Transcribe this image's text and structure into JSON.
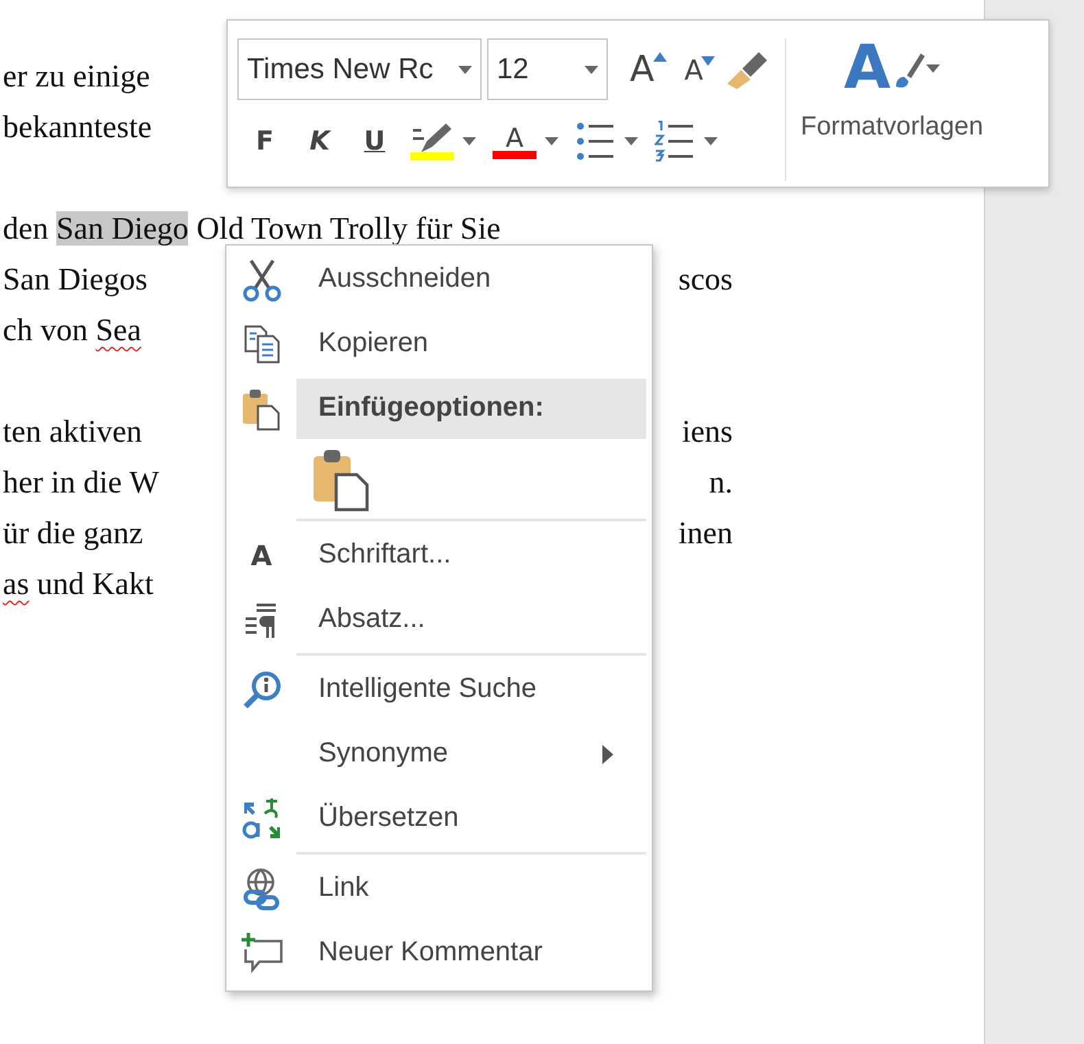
{
  "document": {
    "paragraphs": [
      {
        "lines": [
          {
            "segments": [
              {
                "text": "er zu einige",
                "selected": false,
                "misspelled": false
              }
            ]
          },
          {
            "segments": [
              {
                "text": "bekannteste",
                "selected": false,
                "misspelled": false
              }
            ]
          }
        ]
      },
      {
        "lines": [
          {
            "segments": [
              {
                "text": "den ",
                "selected": false,
                "misspelled": false
              },
              {
                "text": "San Diego",
                "selected": true,
                "misspelled": false
              },
              {
                "text": " Old Town Trolly für Sie",
                "selected": false,
                "misspelled": false
              }
            ]
          },
          {
            "segments": [
              {
                "text": "San Diegos",
                "selected": false,
                "misspelled": false
              }
            ],
            "right": "scos"
          },
          {
            "segments": [
              {
                "text": "ch von ",
                "selected": false,
                "misspelled": false
              },
              {
                "text": "Sea",
                "selected": false,
                "misspelled": true
              }
            ]
          }
        ]
      },
      {
        "lines": [
          {
            "segments": [
              {
                "text": "ten aktiven",
                "selected": false,
                "misspelled": false
              }
            ],
            "right": "iens"
          },
          {
            "segments": [
              {
                "text": "her in die W",
                "selected": false,
                "misspelled": false
              }
            ],
            "right": "n."
          },
          {
            "segments": [
              {
                "text": "ür die ganz",
                "selected": false,
                "misspelled": false
              }
            ],
            "right": "inen"
          },
          {
            "segments": [
              {
                "text": "as",
                "selected": false,
                "misspelled": true
              },
              {
                "text": " und Kakt",
                "selected": false,
                "misspelled": false
              }
            ]
          }
        ]
      }
    ]
  },
  "mini_toolbar": {
    "font": "Times New Rc",
    "size": "12",
    "grow_glyph": "A",
    "shrink_glyph": "A",
    "format_buttons": [
      {
        "kind": "bold",
        "label": "F"
      },
      {
        "kind": "italic",
        "label": "K"
      },
      {
        "kind": "underline",
        "label": "U"
      }
    ],
    "highlight": {
      "color": "#ffff00"
    },
    "font_color": {
      "glyph": "A",
      "color": "#ff0000"
    },
    "styles": {
      "glyph": "A",
      "label": "Formatvorlagen"
    }
  },
  "context_menu": [
    {
      "kind": "item",
      "label": "Ausschneiden",
      "submenu": false
    },
    {
      "kind": "item",
      "label": "Kopieren",
      "submenu": false
    },
    {
      "kind": "header",
      "label": "Einfügeoptionen:"
    },
    {
      "kind": "paste-option"
    },
    {
      "kind": "separator"
    },
    {
      "kind": "item",
      "label": "Schriftart...",
      "glyph": "A",
      "submenu": false
    },
    {
      "kind": "item",
      "label": "Absatz...",
      "submenu": false
    },
    {
      "kind": "separator"
    },
    {
      "kind": "item",
      "label": "Intelligente Suche",
      "submenu": false
    },
    {
      "kind": "item",
      "label": "Synonyme",
      "submenu": true
    },
    {
      "kind": "item",
      "label": "Übersetzen",
      "submenu": false
    },
    {
      "kind": "separator"
    },
    {
      "kind": "item",
      "label": "Link",
      "submenu": false
    },
    {
      "kind": "item",
      "label": "Neuer Kommentar",
      "submenu": false
    }
  ]
}
